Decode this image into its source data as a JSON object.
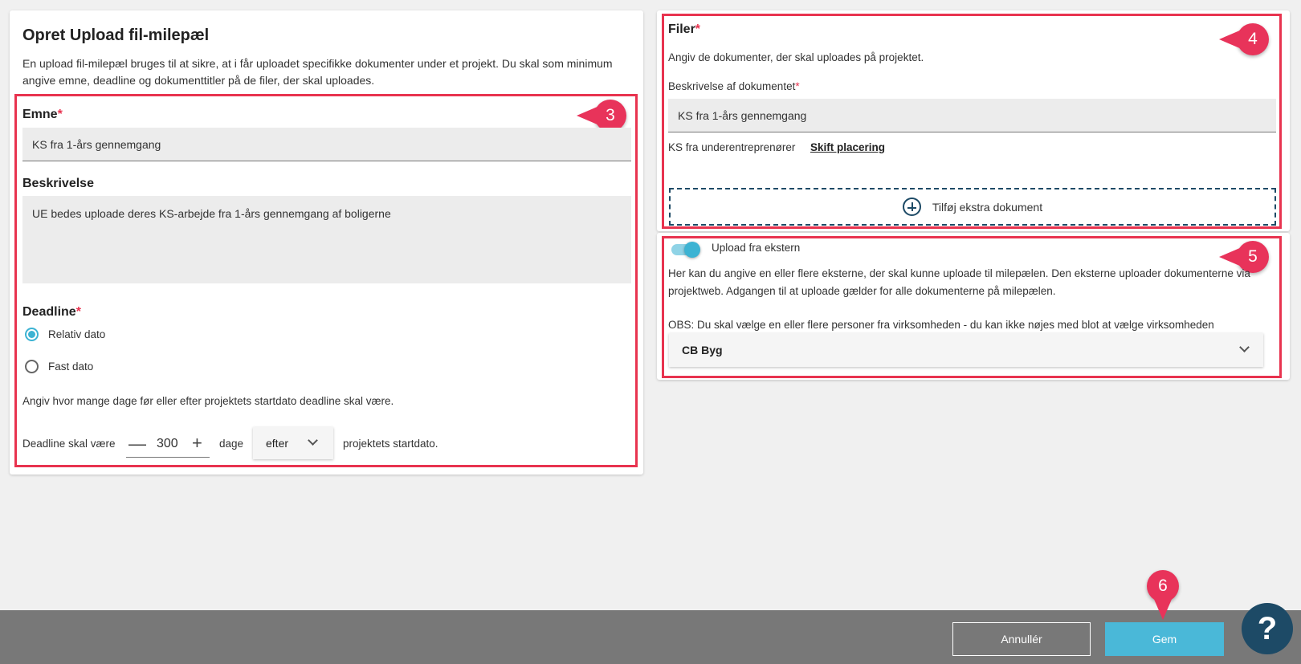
{
  "left_panel": {
    "title": "Opret Upload fil-milepæl",
    "intro_line1": "En upload fil-milepæl bruges til at sikre, at i får uploadet specifikke dokumenter under et projekt. Du skal som minimum",
    "intro_line2": "angive emne, deadline og dokumenttitler på de filer, der skal uploades.",
    "subject_label": "Emne",
    "subject_value": "KS fra 1-års gennemgang",
    "description_label": "Beskrivelse",
    "description_value": "UE bedes uploade deres KS-arbejde fra 1-års gennemgang af boligerne",
    "deadline_label": "Deadline",
    "radio_relative": "Relativ dato",
    "radio_fixed": "Fast dato",
    "deadline_help": "Angiv hvor mange dage før eller efter projektets startdato deadline skal være.",
    "deadline_prefix": "Deadline skal være",
    "deadline_minus": "—",
    "deadline_days": "300",
    "deadline_plus": "+",
    "deadline_days_label": "dage",
    "deadline_direction": "efter",
    "deadline_suffix": "projektets startdato."
  },
  "files_panel": {
    "title": "Filer",
    "help": "Angiv de dokumenter, der skal uploades på projektet.",
    "doc_desc_label": "Beskrivelse af dokumentet",
    "doc_desc_value": "KS fra 1-års gennemgang",
    "location_text": "KS fra underentreprenører",
    "change_location_link": "Skift placering",
    "add_document": "Tilføj ekstra dokument"
  },
  "external_panel": {
    "toggle_label": "Upload fra ekstern",
    "help_line1": "Her kan du angive en eller flere eksterne, der skal kunne uploade til milepælen. Den eksterne uploader dokumenterne via",
    "help_line2": "projektweb. Adgangen til at uploade gælder for alle dokumenterne på milepælen.",
    "obs": "OBS: Du skal vælge en eller flere personer fra virksomheden - du kan ikke nøjes med blot at vælge virksomheden",
    "company_selected": "CB Byg"
  },
  "footer": {
    "cancel_label": "Annullér",
    "save_label": "Gem",
    "help_label": "?"
  },
  "badges": [
    "3",
    "4",
    "5",
    "6"
  ],
  "colors": {
    "highlight": "#e8334f",
    "badge": "#e8335a",
    "accent": "#4ab8d8",
    "dark_blue": "#1d4a66"
  }
}
